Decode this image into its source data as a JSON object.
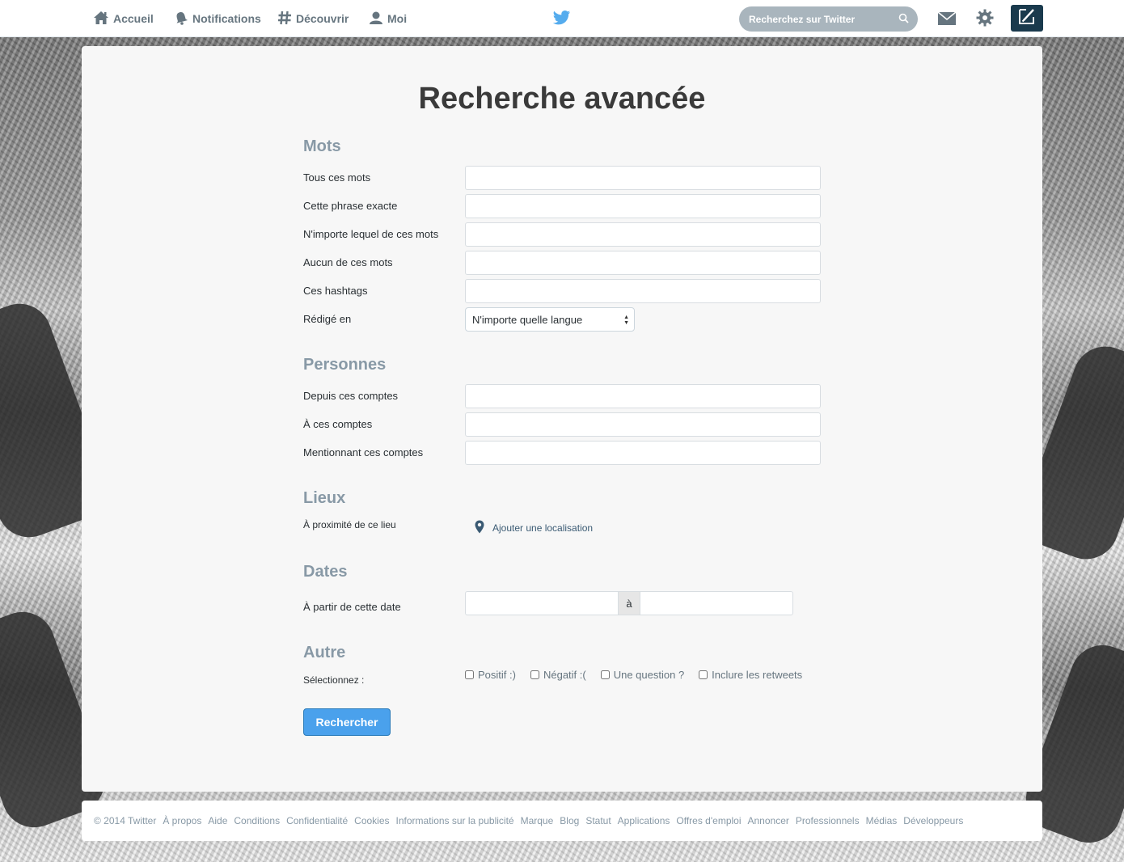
{
  "nav": {
    "home_label": "Accueil",
    "notifications_label": "Notifications",
    "discover_label": "Découvrir",
    "me_label": "Moi",
    "search_placeholder": "Recherchez sur Twitter"
  },
  "page": {
    "title": "Recherche avancée"
  },
  "sections": {
    "words": {
      "title": "Mots",
      "all_words": "Tous ces mots",
      "exact_phrase": "Cette phrase exacte",
      "any_words": "N'importe lequel de ces mots",
      "none_words": "Aucun de ces mots",
      "hashtags": "Ces hashtags",
      "language_label": "Rédigé en",
      "language_value": "N'importe quelle langue"
    },
    "people": {
      "title": "Personnes",
      "from_accounts": "Depuis ces comptes",
      "to_accounts": "À ces comptes",
      "mentioning_accounts": "Mentionnant ces comptes"
    },
    "places": {
      "title": "Lieux",
      "near_label": "À proximité de ce lieu",
      "add_location": "Ajouter une localisation"
    },
    "dates": {
      "title": "Dates",
      "from_label": "À partir de cette date",
      "separator": "à"
    },
    "other": {
      "title": "Autre",
      "select_label": "Sélectionnez :",
      "positive": "Positif :)",
      "negative": "Négatif :(",
      "question": "Une question ?",
      "retweets": "Inclure les retweets"
    }
  },
  "actions": {
    "search_button": "Rechercher"
  },
  "footer": {
    "items": [
      "© 2014 Twitter",
      "À propos",
      "Aide",
      "Conditions",
      "Confidentialité",
      "Cookies",
      "Informations sur la publicité",
      "Marque",
      "Blog",
      "Statut",
      "Applications",
      "Offres d'emploi",
      "Annoncer",
      "Professionnels",
      "Médias",
      "Développeurs"
    ]
  },
  "icons": {
    "home": "home-icon",
    "notifications": "bell-icon",
    "discover": "hashtag-icon",
    "me": "person-icon",
    "logo": "twitter-bird-icon",
    "search": "search-icon",
    "messages": "envelope-icon",
    "settings": "gear-icon",
    "compose": "compose-icon",
    "location": "map-pin-icon"
  },
  "colors": {
    "accent": "#4aa1ec",
    "twitter_blue": "#55acee",
    "section_title": "#8899a6",
    "compose_bg": "#1a3a4d"
  }
}
